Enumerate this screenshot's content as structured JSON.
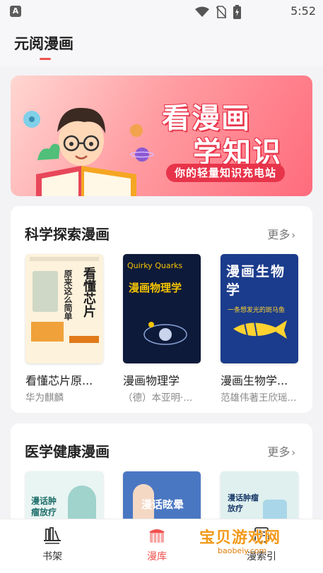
{
  "status_bar": {
    "app_glyph": "A",
    "time": "5:52"
  },
  "header": {
    "title": "元阅漫画"
  },
  "banner": {
    "line1": "看漫画",
    "line2": "学知识",
    "slogan": "你的轻量知识充电站"
  },
  "sections": [
    {
      "title": "科学探索漫画",
      "more": "更多",
      "books": [
        {
          "title": "看懂芯片原...",
          "author": "华为麒麟",
          "cover_title": "看懂芯片",
          "cover_sub": "原来这么简单",
          "cover_bg": "#fdf2dc",
          "cover_accent": "#e07a1a"
        },
        {
          "title": "漫画物理学",
          "author": "（德）本亚明·...",
          "cover_en": "Quirky Quarks",
          "cover_title": "漫画物理学",
          "cover_bg": "#0e1a3a",
          "cover_accent": "#f5c400"
        },
        {
          "title": "漫画生物学...",
          "author": "范雄伟著王欣瑶...",
          "cover_title": "漫画生物学",
          "cover_sub": "一条想发光的斑马鱼",
          "cover_bg": "#1b3c8c",
          "cover_accent": "#ffd230"
        }
      ]
    },
    {
      "title": "医学健康漫画",
      "more": "更多",
      "books": [
        {
          "cover_title": "漫话肿瘤放疗",
          "cover_bg": "#e9f5f3",
          "cover_accent": "#1f6f6a"
        },
        {
          "cover_title": "漫话眩晕",
          "cover_bg": "#4a77c2",
          "cover_accent": "#ffd54a"
        },
        {
          "cover_title": "漫话肿瘤放疗",
          "cover_bg": "#dff0ef",
          "cover_accent": "#1a3a6a"
        }
      ]
    }
  ],
  "bottom_nav": [
    {
      "label": "书架",
      "icon": "bookshelf-icon",
      "active": false
    },
    {
      "label": "漫库",
      "icon": "comic-library-icon",
      "active": true
    },
    {
      "label": "漫索引",
      "icon": "index-icon",
      "active": false
    }
  ],
  "watermark": {
    "text": "宝贝游戏网",
    "url": "baobeiy.com"
  },
  "colors": {
    "accent": "#f0524f",
    "banner_red": "#e8344a",
    "page_bg": "#f3f3f5"
  }
}
